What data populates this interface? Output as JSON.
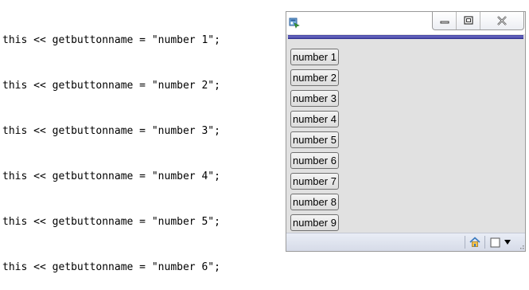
{
  "editor": {
    "lines": [
      "this << getbuttonname = \"number 1\";",
      "this << getbuttonname = \"number 2\";",
      "this << getbuttonname = \"number 3\";",
      "this << getbuttonname = \"number 4\";",
      "this << getbuttonname = \"number 5\";",
      "this << getbuttonname = \"number 6\";"
    ]
  },
  "window": {
    "app_icon": "app-window-icon",
    "controls": [
      "minimize-icon",
      "maximize-icon",
      "close-icon"
    ],
    "buttons": [
      "number 1",
      "number 2",
      "number 3",
      "number 4",
      "number 5",
      "number 6",
      "number 7",
      "number 8",
      "number 9"
    ],
    "statusbar_icons": [
      "home-icon",
      "checkbox-icon",
      "dropdown-arrow-icon"
    ],
    "accent": "#3c3c9a"
  }
}
